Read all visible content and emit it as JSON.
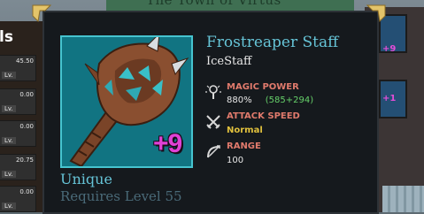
{
  "background": {
    "banner_text": "The Town of Virtus",
    "left_panel_title": "ls",
    "left_stats": [
      {
        "value": "45.50",
        "lv": "Lv."
      },
      {
        "value": "0.00",
        "lv": "Lv."
      },
      {
        "value": "0.00",
        "lv": "Lv."
      },
      {
        "value": "20.75",
        "lv": "Lv."
      },
      {
        "value": "0.00",
        "lv": "Lv."
      }
    ],
    "right_badges": [
      "+9",
      "+1"
    ]
  },
  "item": {
    "name": "Frostreaper Staff",
    "type": "IceStaff",
    "enchant": "+9",
    "rarity": "Unique",
    "requirement": "Requires Level 55"
  },
  "stats": {
    "magic_power": {
      "label": "MAGIC POWER",
      "value": "880%",
      "bonus": "(585+294)",
      "icon": "magic-staff-icon"
    },
    "attack_speed": {
      "label": "ATTACK SPEED",
      "value": "Normal",
      "icon": "crossed-swords-icon"
    },
    "range": {
      "label": "RANGE",
      "value": "100",
      "icon": "bow-icon"
    }
  },
  "colors": {
    "name": "#66c4d7",
    "stat_label": "#e07a6c",
    "bonus": "#66d16a",
    "speed": "#e1c13d",
    "enchant": "#e041d6",
    "tooltip_bg": "#15191d"
  }
}
